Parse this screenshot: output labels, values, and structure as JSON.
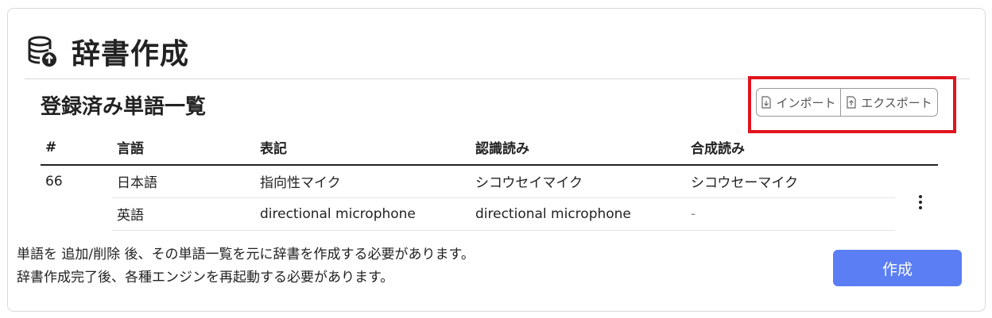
{
  "page": {
    "title": "辞書作成",
    "icon": "database-upload-icon"
  },
  "section": {
    "title": "登録済み単語一覧"
  },
  "actions": {
    "import_label": "インポート",
    "export_label": "エクスポート"
  },
  "table": {
    "headers": [
      "#",
      "言語",
      "表記",
      "認識読み",
      "合成読み"
    ],
    "rows": [
      {
        "num": "66",
        "language": "日本語",
        "notation": "指向性マイク",
        "recognition": "シコウセイマイク",
        "synthesis": "シコウセーマイク"
      },
      {
        "num": "",
        "language": "英語",
        "notation": "directional microphone",
        "recognition": "directional microphone",
        "synthesis": "-"
      }
    ]
  },
  "notes": {
    "line1": "単語を 追加/削除 後、その単語一覧を元に辞書を作成する必要があります。",
    "line2": "辞書作成完了後、各種エンジンを再起動する必要があります。"
  },
  "create_button": {
    "label": "作成"
  },
  "colors": {
    "accent": "#5b7ef5",
    "highlight": "#e0141e"
  }
}
